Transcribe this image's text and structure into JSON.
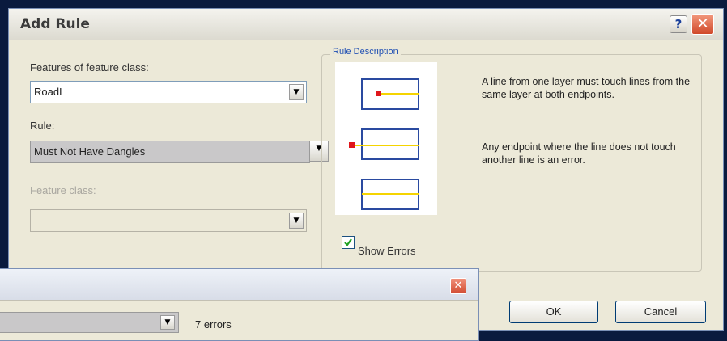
{
  "dialog": {
    "title": "Add Rule",
    "help_label": "?",
    "close_label": "✕"
  },
  "features": {
    "label": "Features of feature class:",
    "value": "RoadL"
  },
  "rule": {
    "label": "Rule:",
    "value": "Must Not Have Dangles"
  },
  "feature_class": {
    "label": "Feature class:",
    "value": ""
  },
  "rule_description": {
    "title": "Rule Description",
    "paragraph1": "A line from one layer must touch lines from the same layer at both endpoints.",
    "paragraph2": "Any endpoint where the line does not touch another line is an error."
  },
  "show_errors": {
    "label": "Show Errors",
    "checked": true
  },
  "buttons": {
    "ok": "OK",
    "cancel": "Cancel"
  },
  "second_dialog": {
    "close_label": "✕",
    "error_count": "7 errors"
  },
  "colors": {
    "error_point": "#e0161b",
    "line": "#f5d400",
    "box_border": "#2a4aa0"
  }
}
